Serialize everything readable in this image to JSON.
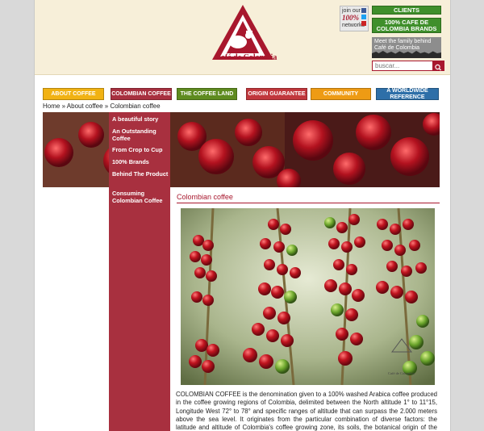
{
  "header": {
    "logo_text": "Café de Colombia",
    "join_text": "join our",
    "join_number": "100%",
    "join_networks": "networks",
    "clients_label": "CLIENTS",
    "brands_label": "100% CAFE DE COLOMBIA BRANDS",
    "meet_family_label": "Meet the family behind Café de Colombia",
    "search_placeholder": "buscar..."
  },
  "nav": {
    "items": [
      {
        "label": "ABOUT COFFEE",
        "color": "#f1b213"
      },
      {
        "label": "COLOMBIAN COFFEE",
        "color": "#a8303f"
      },
      {
        "label": "THE COFFEE LAND",
        "color": "#5e8b1f"
      },
      {
        "label": "ORIGIN GUARANTEE",
        "color": "#c1373c"
      },
      {
        "label": "COMMUNITY",
        "color": "#ee9b14"
      },
      {
        "label": "A WORLDWIDE REFERENCE",
        "color": "#2e6fa8"
      }
    ]
  },
  "breadcrumb": "Home » About coffee » Colombian coffee",
  "sidebar": {
    "items": [
      {
        "label": "A beautiful story"
      },
      {
        "label": "An Outstanding Coffee"
      },
      {
        "label": "From Crop to Cup"
      },
      {
        "label": "100% Brands"
      },
      {
        "label": "Behind The Product"
      },
      {
        "label": "Consuming Colombian Coffee"
      }
    ]
  },
  "content": {
    "title": "Colombian coffee",
    "photo_caption": "Café de Colombia",
    "body": "COLOMBIAN COFFEE is the denomination given to a 100% washed Arabica coffee produced in the coffee growing regions of Colombia, delimited between the North altitude 1° to 11°15, Longitude West 72° to 78° and specific ranges of altitude that can surpass the 2.000 meters above the sea level.  It originates from the particular combination of diverse factors:  the latitude and altitude of Colombia's coffee growing zone, its soils, the botanical origin of the species and"
  },
  "colors": {
    "brand_red": "#a8172d",
    "green_button": "#3f8f2b",
    "sidebar_red": "#a8303f",
    "header_cream": "#f7efd9"
  }
}
